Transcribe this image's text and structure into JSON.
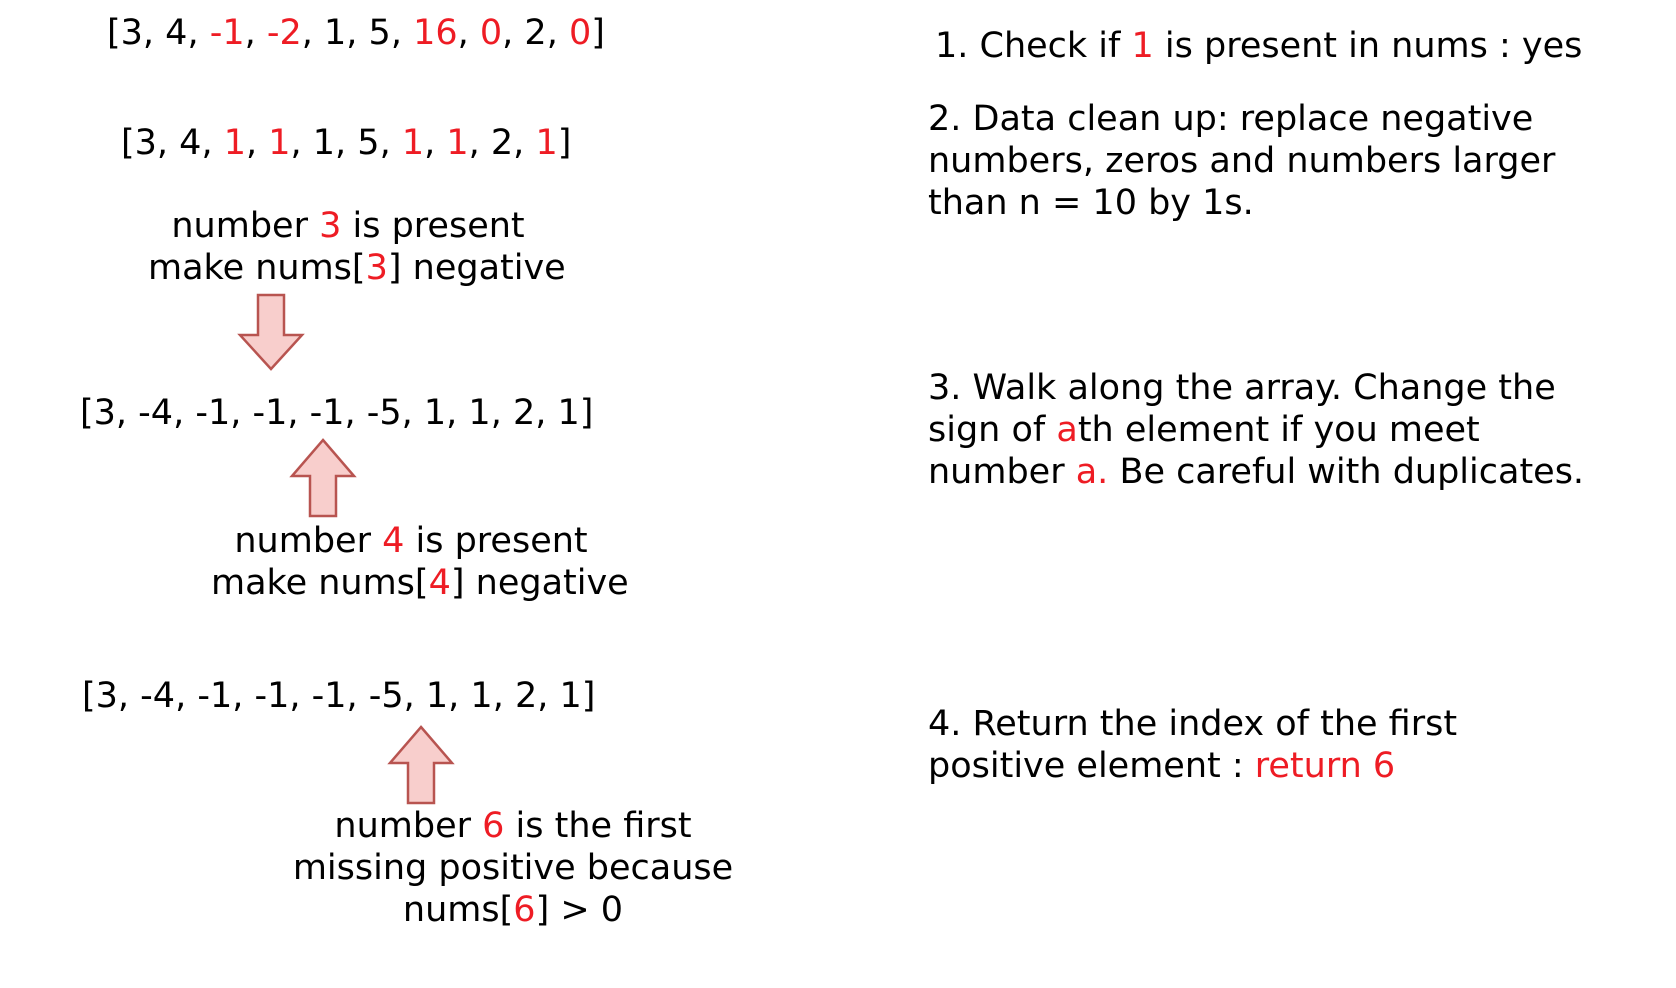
{
  "colors": {
    "text": "#000000",
    "highlight": "#ee1c24",
    "arrow_fill": "#f8cecc",
    "arrow_stroke": "#b85450"
  },
  "left": {
    "array_original": [
      "[3, 4, ",
      "-1",
      ", ",
      "-2",
      ", 1, 5, ",
      "16",
      ", ",
      "0",
      ", 2, ",
      "0",
      "]"
    ],
    "array_cleaned": [
      "[3, 4, ",
      "1",
      ", ",
      "1",
      ", 1, 5, ",
      "1",
      ", ",
      "1",
      ", 2, ",
      "1",
      "]"
    ],
    "note3": {
      "line1": [
        "number ",
        "3",
        " is present"
      ],
      "line2": [
        "make nums[",
        "3",
        "] negative"
      ]
    },
    "array_marked_1": "[3, -4, -1, -1, -1, -5, 1, 1, 2, 1]",
    "note4": {
      "line1": [
        "number ",
        "4",
        " is present"
      ],
      "line2": [
        "make nums[",
        "4",
        "] negative"
      ]
    },
    "array_marked_2": "[3, -4, -1, -1, -1, -5, 1, 1, 2, 1]",
    "note6": {
      "line1": [
        "number ",
        "6",
        " is the first"
      ],
      "line2": "missing positive because",
      "line3": [
        "nums[",
        "6",
        "] > 0"
      ]
    },
    "arrows": [
      "down-arrow-icon",
      "up-arrow-icon",
      "up-arrow-icon"
    ]
  },
  "right": {
    "step1": [
      "1. Check if ",
      "1",
      " is present in nums : yes"
    ],
    "step2": {
      "line1": "2. Data clean up: replace negative",
      "line2": "numbers, zeros and numbers larger",
      "line3": "than n = 10 by 1s."
    },
    "step3": {
      "line1": "3. Walk along the array. Change the",
      "line2": [
        "sign of ",
        "a",
        "th element if you meet"
      ],
      "line3": [
        "number ",
        "a.",
        " Be careful with duplicates."
      ]
    },
    "step4": {
      "line1": "4. Return the index of the first",
      "line2": [
        "positive element : ",
        "return 6"
      ]
    }
  }
}
